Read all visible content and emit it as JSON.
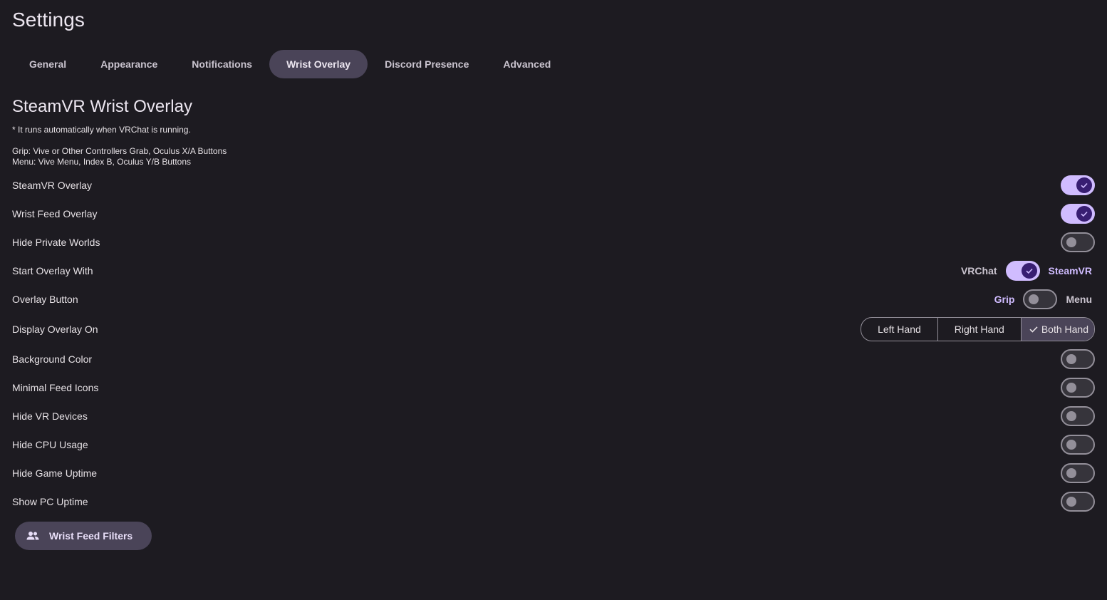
{
  "page": {
    "title": "Settings"
  },
  "tabs": [
    {
      "label": "General",
      "active": false
    },
    {
      "label": "Appearance",
      "active": false
    },
    {
      "label": "Notifications",
      "active": false
    },
    {
      "label": "Wrist Overlay",
      "active": true
    },
    {
      "label": "Discord Presence",
      "active": false
    },
    {
      "label": "Advanced",
      "active": false
    }
  ],
  "section": {
    "title": "SteamVR Wrist Overlay",
    "note": "* It runs automatically when VRChat is running.",
    "grip_info": "Grip: Vive or Other Controllers Grab, Oculus X/A Buttons",
    "menu_info": "Menu: Vive Menu, Index B, Oculus Y/B Buttons"
  },
  "settings": {
    "steamvr_overlay": {
      "label": "SteamVR Overlay",
      "on": true
    },
    "wrist_feed_overlay": {
      "label": "Wrist Feed Overlay",
      "on": true
    },
    "hide_private_worlds": {
      "label": "Hide Private Worlds",
      "on": false
    },
    "start_overlay_with": {
      "label": "Start Overlay With",
      "left": "VRChat",
      "right": "SteamVR",
      "on": true
    },
    "overlay_button": {
      "label": "Overlay Button",
      "left": "Grip",
      "right": "Menu",
      "on": false
    },
    "display_overlay_on": {
      "label": "Display Overlay On",
      "options": [
        "Left Hand",
        "Right Hand",
        "Both Hand"
      ],
      "selected": "Both Hand"
    },
    "background_color": {
      "label": "Background Color",
      "on": false
    },
    "minimal_feed_icons": {
      "label": "Minimal Feed Icons",
      "on": false
    },
    "hide_vr_devices": {
      "label": "Hide VR Devices",
      "on": false
    },
    "hide_cpu_usage": {
      "label": "Hide CPU Usage",
      "on": false
    },
    "hide_game_uptime": {
      "label": "Hide Game Uptime",
      "on": false
    },
    "show_pc_uptime": {
      "label": "Show PC Uptime",
      "on": false
    }
  },
  "filter_button": {
    "label": "Wrist Feed Filters",
    "icon": "people-icon"
  },
  "colors": {
    "background": "#1d1b21",
    "accent": "#d0bcff",
    "accent_dark": "#381e72",
    "tab_active": "#4a4458"
  }
}
